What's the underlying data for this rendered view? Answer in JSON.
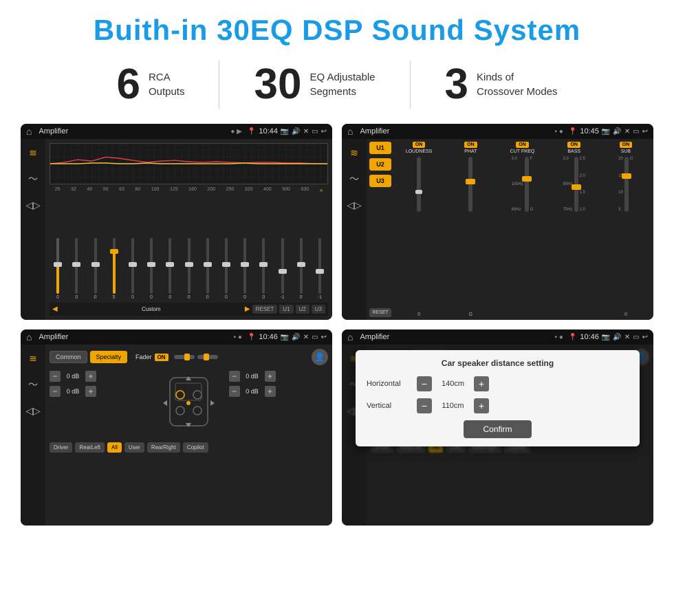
{
  "page": {
    "title": "Buith-in 30EQ DSP Sound System"
  },
  "stats": [
    {
      "number": "6",
      "label_line1": "RCA",
      "label_line2": "Outputs"
    },
    {
      "number": "30",
      "label_line1": "EQ Adjustable",
      "label_line2": "Segments"
    },
    {
      "number": "3",
      "label_line1": "Kinds of",
      "label_line2": "Crossover Modes"
    }
  ],
  "screens": [
    {
      "id": "screen1",
      "status_title": "Amplifier",
      "time": "10:44",
      "preset": "Custom",
      "bottom_btns": [
        "RESET",
        "U1",
        "U2",
        "U3"
      ]
    },
    {
      "id": "screen2",
      "status_title": "Amplifier",
      "time": "10:45",
      "channels": [
        "LOUDNESS",
        "PHAT",
        "CUT FREQ",
        "BASS",
        "SUB"
      ]
    },
    {
      "id": "screen3",
      "status_title": "Amplifier",
      "time": "10:46",
      "tabs": [
        "Common",
        "Specialty"
      ],
      "fader_label": "Fader",
      "bottom_btns": [
        "Driver",
        "RearLeft",
        "All",
        "User",
        "RearRight",
        "Copilot"
      ]
    },
    {
      "id": "screen4",
      "status_title": "Amplifier",
      "time": "10:46",
      "dialog": {
        "title": "Car speaker distance setting",
        "horizontal_label": "Horizontal",
        "horizontal_value": "140cm",
        "vertical_label": "Vertical",
        "vertical_value": "110cm",
        "confirm_label": "Confirm"
      },
      "bottom_btns": [
        "Driver",
        "RearLeft",
        "All",
        "User",
        "RearRight",
        "Copilot"
      ]
    }
  ],
  "eq_freqs": [
    "25",
    "32",
    "40",
    "50",
    "63",
    "80",
    "100",
    "125",
    "160",
    "200",
    "250",
    "320",
    "400",
    "500",
    "630"
  ],
  "eq_values": [
    "0",
    "0",
    "0",
    "5",
    "0",
    "0",
    "0",
    "0",
    "0",
    "0",
    "0",
    "0",
    "-1",
    "0",
    "-1"
  ],
  "eq_thumbs": [
    50,
    50,
    50,
    30,
    50,
    50,
    50,
    50,
    50,
    50,
    50,
    50,
    65,
    50,
    65
  ]
}
